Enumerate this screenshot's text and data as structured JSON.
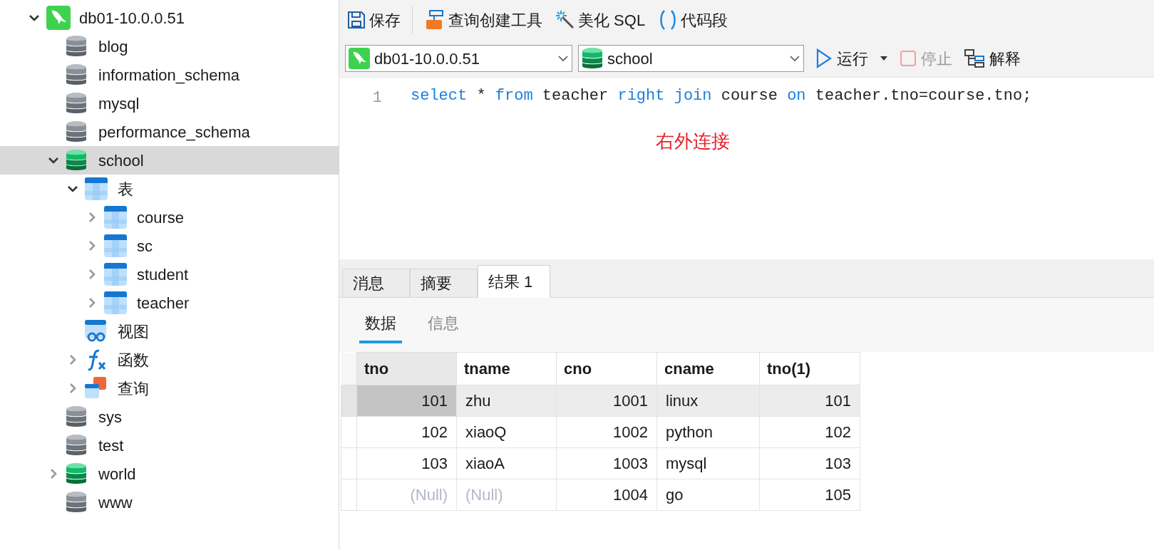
{
  "tree": [
    {
      "kind": "connection",
      "label": "db01-10.0.0.51",
      "expanded": true,
      "selected": false,
      "children": [
        {
          "kind": "database",
          "label": "blog",
          "open": false,
          "selected": false
        },
        {
          "kind": "database",
          "label": "information_schema",
          "open": false,
          "selected": false
        },
        {
          "kind": "database",
          "label": "mysql",
          "open": false,
          "selected": false
        },
        {
          "kind": "database",
          "label": "performance_schema",
          "open": false,
          "selected": false
        },
        {
          "kind": "database",
          "label": "school",
          "open": true,
          "expanded": true,
          "selected": true,
          "children": [
            {
              "kind": "tables",
              "label": "表",
              "expanded": true,
              "selected": false,
              "children": [
                {
                  "kind": "table",
                  "label": "course",
                  "expanded": false,
                  "selected": false
                },
                {
                  "kind": "table",
                  "label": "sc",
                  "expanded": false,
                  "selected": false
                },
                {
                  "kind": "table",
                  "label": "student",
                  "expanded": false,
                  "selected": false
                },
                {
                  "kind": "table",
                  "label": "teacher",
                  "expanded": false,
                  "selected": false
                }
              ]
            },
            {
              "kind": "views",
              "label": "视图",
              "selected": false
            },
            {
              "kind": "functions",
              "label": "函数",
              "expanded": false,
              "selected": false
            },
            {
              "kind": "queries",
              "label": "查询",
              "expanded": false,
              "selected": false
            }
          ]
        },
        {
          "kind": "database",
          "label": "sys",
          "open": false,
          "selected": false
        },
        {
          "kind": "database",
          "label": "test",
          "open": false,
          "selected": false
        },
        {
          "kind": "database",
          "label": "world",
          "open": true,
          "expanded": false,
          "selected": false
        },
        {
          "kind": "database",
          "label": "www",
          "open": false,
          "selected": false
        }
      ]
    }
  ],
  "toolbar": [
    {
      "kind": "save",
      "label": "保存"
    },
    {
      "kind": "separator"
    },
    {
      "kind": "builder",
      "label": "查询创建工具"
    },
    {
      "kind": "beautify",
      "label": "美化 SQL"
    },
    {
      "kind": "snippet",
      "label": "代码段"
    }
  ],
  "connection_select": {
    "kind": "connection",
    "value": "db01-10.0.0.51"
  },
  "database_select": {
    "kind": "database",
    "value": "school"
  },
  "actions": [
    {
      "kind": "run",
      "label": "运行",
      "disabled": false
    },
    {
      "kind": "stop",
      "label": "停止",
      "disabled": true
    },
    {
      "kind": "explain",
      "label": "解释",
      "disabled": false
    }
  ],
  "editor": {
    "line_number": "1",
    "tokens": [
      {
        "kind": "keyword",
        "text": "select"
      },
      {
        "kind": "plain",
        "text": " * "
      },
      {
        "kind": "keyword",
        "text": "from"
      },
      {
        "kind": "plain",
        "text": " teacher "
      },
      {
        "kind": "keyword",
        "text": "right join"
      },
      {
        "kind": "plain",
        "text": " course "
      },
      {
        "kind": "keyword",
        "text": "on"
      },
      {
        "kind": "plain",
        "text": " teacher.tno=course.tno;"
      }
    ],
    "annotation": "右外连接"
  },
  "result_tabs": [
    {
      "label": "消息",
      "selected": false
    },
    {
      "label": "摘要",
      "selected": false
    },
    {
      "label": "结果 1",
      "selected": true
    }
  ],
  "sub_tabs": [
    {
      "label": "数据",
      "selected": true
    },
    {
      "label": "信息",
      "selected": false
    }
  ],
  "table": {
    "columns": [
      {
        "label": "tno",
        "selected": true
      },
      {
        "label": "tname",
        "selected": false
      },
      {
        "label": "cno",
        "selected": false
      },
      {
        "label": "cname",
        "selected": false
      },
      {
        "label": "tno(1)",
        "selected": false
      }
    ],
    "rows": [
      {
        "selected": true,
        "cells": [
          {
            "text": "101",
            "kind": "number",
            "null": false,
            "focused": true
          },
          {
            "text": "zhu",
            "kind": "text",
            "null": false,
            "focused": false
          },
          {
            "text": "1001",
            "kind": "number",
            "null": false,
            "focused": false
          },
          {
            "text": "linux",
            "kind": "text",
            "null": false,
            "focused": false
          },
          {
            "text": "101",
            "kind": "number",
            "null": false,
            "focused": false
          }
        ]
      },
      {
        "selected": false,
        "cells": [
          {
            "text": "102",
            "kind": "number",
            "null": false,
            "focused": false
          },
          {
            "text": "xiaoQ",
            "kind": "text",
            "null": false,
            "focused": false
          },
          {
            "text": "1002",
            "kind": "number",
            "null": false,
            "focused": false
          },
          {
            "text": "python",
            "kind": "text",
            "null": false,
            "focused": false
          },
          {
            "text": "102",
            "kind": "number",
            "null": false,
            "focused": false
          }
        ]
      },
      {
        "selected": false,
        "cells": [
          {
            "text": "103",
            "kind": "number",
            "null": false,
            "focused": false
          },
          {
            "text": "xiaoA",
            "kind": "text",
            "null": false,
            "focused": false
          },
          {
            "text": "1003",
            "kind": "number",
            "null": false,
            "focused": false
          },
          {
            "text": "mysql",
            "kind": "text",
            "null": false,
            "focused": false
          },
          {
            "text": "103",
            "kind": "number",
            "null": false,
            "focused": false
          }
        ]
      },
      {
        "selected": false,
        "cells": [
          {
            "text": "(Null)",
            "kind": "number",
            "null": true,
            "focused": false
          },
          {
            "text": "(Null)",
            "kind": "text",
            "null": true,
            "focused": false
          },
          {
            "text": "1004",
            "kind": "number",
            "null": false,
            "focused": false
          },
          {
            "text": "go",
            "kind": "text",
            "null": false,
            "focused": false
          },
          {
            "text": "105",
            "kind": "number",
            "null": false,
            "focused": false
          }
        ]
      }
    ]
  }
}
